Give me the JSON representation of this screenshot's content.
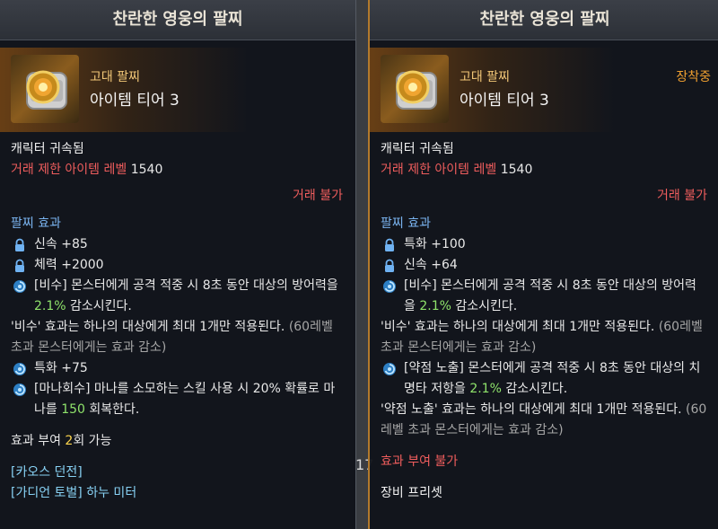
{
  "background": {
    "number": "17"
  },
  "left": {
    "title": "찬란한 영웅의 팔찌",
    "grade": "고대 팔찌",
    "tier": "아이템 티어 3",
    "bound": "캐릭터 귀속됨",
    "trade_limit_label": "거래 제한 아이템 레벨",
    "trade_limit_value": "1540",
    "trade_status": "거래 불가",
    "effects_header": "팔찌 효과",
    "stats": [
      {
        "label": "신속 +85",
        "icon": "lock-icon"
      },
      {
        "label": "체력 +2000",
        "icon": "lock-icon"
      }
    ],
    "effect1": {
      "pre": "[비수] 몬스터에게 공격 적중 시 8초 동안 대상의 방어력을 ",
      "value": "2.1%",
      "post": " 감소시킨다.",
      "note": "'비수' 효과는 하나의 대상에게 최대 1개만 적용된다. ",
      "note_gray": "(60레벨 초과 몬스터에게는 효과 감소)"
    },
    "stat3": "특화 +75",
    "effect2": {
      "pre": "[마나회수] 마나를 소모하는 스킬 사용 시 20% 확률로 마나를 ",
      "value": "150",
      "post": " 회복한다."
    },
    "grant_pre": "효과 부여 ",
    "grant_value": "2",
    "grant_post": "회 가능",
    "source1": "[카오스 던전]",
    "source2": "[가디언 토벌] 하누 미터"
  },
  "right": {
    "title": "찬란한 영웅의 팔찌",
    "grade": "고대 팔찌",
    "tier": "아이템 티어 3",
    "equipped": "장착중",
    "bound": "캐릭터 귀속됨",
    "trade_limit_label": "거래 제한 아이템 레벨",
    "trade_limit_value": "1540",
    "trade_status": "거래 불가",
    "effects_header": "팔찌 효과",
    "stats": [
      {
        "label": "특화 +100",
        "icon": "lock-icon"
      },
      {
        "label": "신속 +64",
        "icon": "lock-icon"
      }
    ],
    "effect1": {
      "pre": "[비수] 몬스터에게 공격 적중 시 8초 동안 대상의 방어력을 ",
      "value": "2.1%",
      "post": " 감소시킨다.",
      "note": "'비수' 효과는 하나의 대상에게 최대 1개만 적용된다. ",
      "note_gray": "(60레벨 초과 몬스터에게는 효과 감소)"
    },
    "effect2": {
      "pre": "[약점 노출] 몬스터에게 공격 적중 시 8초 동안 대상의 치명타 저항을 ",
      "value": "2.1%",
      "post": " 감소시킨다.",
      "note": "'약점 노출' 효과는 하나의 대상에게 최대 1개만 적용된다. ",
      "note_gray": "(60레벨 초과 몬스터에게는 효과 감소)"
    },
    "grant_status": "효과 부여 불가",
    "preset": "장비 프리셋"
  },
  "colors": {
    "accent_border": "#b37a2c",
    "section": "#7ab4f0",
    "warning": "#ef5d5d",
    "highlight_green": "#8fe36b",
    "highlight_yellow": "#ffd64d"
  }
}
